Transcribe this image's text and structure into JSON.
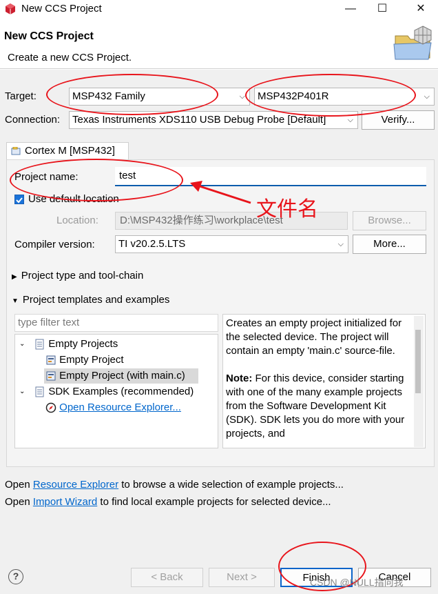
{
  "window": {
    "title": "New CCS Project",
    "minimize_glyph": "—",
    "maximize_glyph": "☐",
    "close_glyph": "✕"
  },
  "header": {
    "title": "New CCS Project",
    "description": "Create a new CCS Project."
  },
  "target": {
    "label": "Target:",
    "family": "MSP432 Family",
    "device": "MSP432P401R"
  },
  "connection": {
    "label": "Connection:",
    "value": "Texas Instruments XDS110 USB Debug Probe [Default]",
    "verify_label": "Verify..."
  },
  "tab": {
    "label": "Cortex M [MSP432]"
  },
  "project": {
    "name_label": "Project name:",
    "name_value": "test",
    "use_default_label": "Use default location",
    "use_default_checked": true,
    "location_label": "Location:",
    "location_value": "D:\\MSP432操作练习\\workplace\\test",
    "browse_label": "Browse...",
    "compiler_label": "Compiler version:",
    "compiler_value": "TI v20.2.5.LTS",
    "more_label": "More..."
  },
  "sections": {
    "toolchain": "Project type and tool-chain",
    "templates": "Project templates and examples"
  },
  "templates": {
    "filter_placeholder": "type filter text",
    "tree": [
      {
        "label": "Empty Projects",
        "expanded": true
      },
      {
        "label": "Empty Project"
      },
      {
        "label": "Empty Project (with main.c)",
        "selected": true
      },
      {
        "label": "SDK Examples (recommended)",
        "expanded": true
      },
      {
        "label": "Open Resource Explorer..."
      }
    ],
    "description": {
      "line1": "Creates an empty project initialized for the selected device. The project will contain an empty 'main.c' source-file.",
      "note_label": "Note:",
      "note_text": " For this device, consider starting with one of the many example projects from the Software Development Kit (SDK). SDK lets you do more with your projects, and"
    }
  },
  "footer_links": {
    "line1_prefix": "Open ",
    "line1_link": "Resource Explorer",
    "line1_suffix": " to browse a wide selection of example projects...",
    "line2_prefix": "Open ",
    "line2_link": "Import Wizard",
    "line2_suffix": " to find local example projects for selected device..."
  },
  "buttons": {
    "help": "?",
    "back": "< Back",
    "next": "Next >",
    "finish": "Finish",
    "cancel": "Cancel"
  },
  "annotation": {
    "text": "文件名",
    "color": "#e8141b"
  },
  "watermark": "CSDN @NULL指向我"
}
